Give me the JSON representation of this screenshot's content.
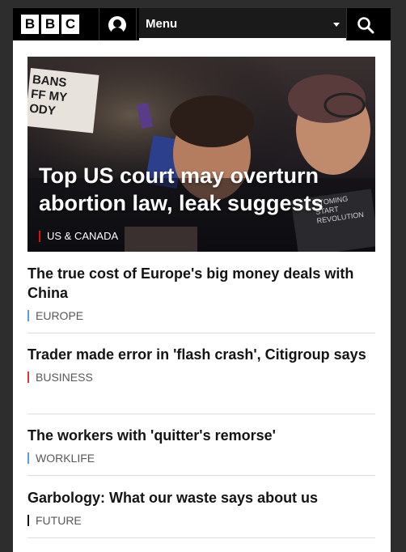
{
  "header": {
    "logo_letters": [
      "B",
      "B",
      "C"
    ],
    "account_icon": "account-icon",
    "menu_label": "Menu",
    "menu_caret_icon": "chevron-down-icon",
    "search_icon": "search-icon"
  },
  "hero": {
    "title": "Top US court may overturn abortion law, leak suggests",
    "tag": "US & CANADA",
    "tag_color": "#e10f00",
    "sign_text": [
      "BANS",
      "FF MY",
      "ODY"
    ],
    "right_sign_text": [
      "STOMING",
      "START",
      "REVOLUTION"
    ]
  },
  "stories": [
    {
      "title": "The true cost of Europe's big money deals with China",
      "tag": "EUROPE",
      "tag_color": "#5b9bd5"
    },
    {
      "title": "Trader made error in 'flash crash', Citigroup says",
      "tag": "BUSINESS",
      "tag_color": "#d9382b"
    },
    {
      "title": "The workers with 'quitter's remorse'",
      "tag": "WORKLIFE",
      "tag_color": "#5b9bd5"
    },
    {
      "title": "Garbology: What our waste says about us",
      "tag": "FUTURE",
      "tag_color": "#141414"
    }
  ]
}
